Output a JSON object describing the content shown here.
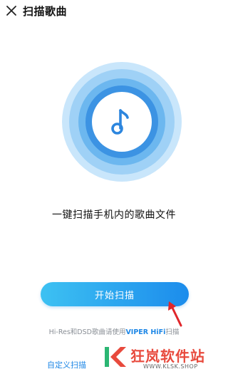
{
  "header": {
    "title": "扫描歌曲",
    "close_icon": "close-icon"
  },
  "illustration": {
    "icon": "music-note-icon",
    "ring_colors": [
      "#c9e6fb",
      "#9fd1f6",
      "#6cb7ef",
      "#3c93e3"
    ]
  },
  "main": {
    "subtitle": "一键扫描手机内的歌曲文件",
    "scan_button_label": "开始扫描",
    "hint_prefix": "Hi-Res和DSD歌曲请使用",
    "hint_link": "VIPER HiFi",
    "hint_suffix": "扫描",
    "custom_scan_label": "自定义扫描"
  },
  "watermark": {
    "text": "狂岚软件站",
    "sub": "WWW.KLSK.SHOP"
  },
  "colors": {
    "accent": "#1e87e6",
    "button_start": "#3dc1f2",
    "button_end": "#1c8cec",
    "arrow": "#e0262b"
  }
}
